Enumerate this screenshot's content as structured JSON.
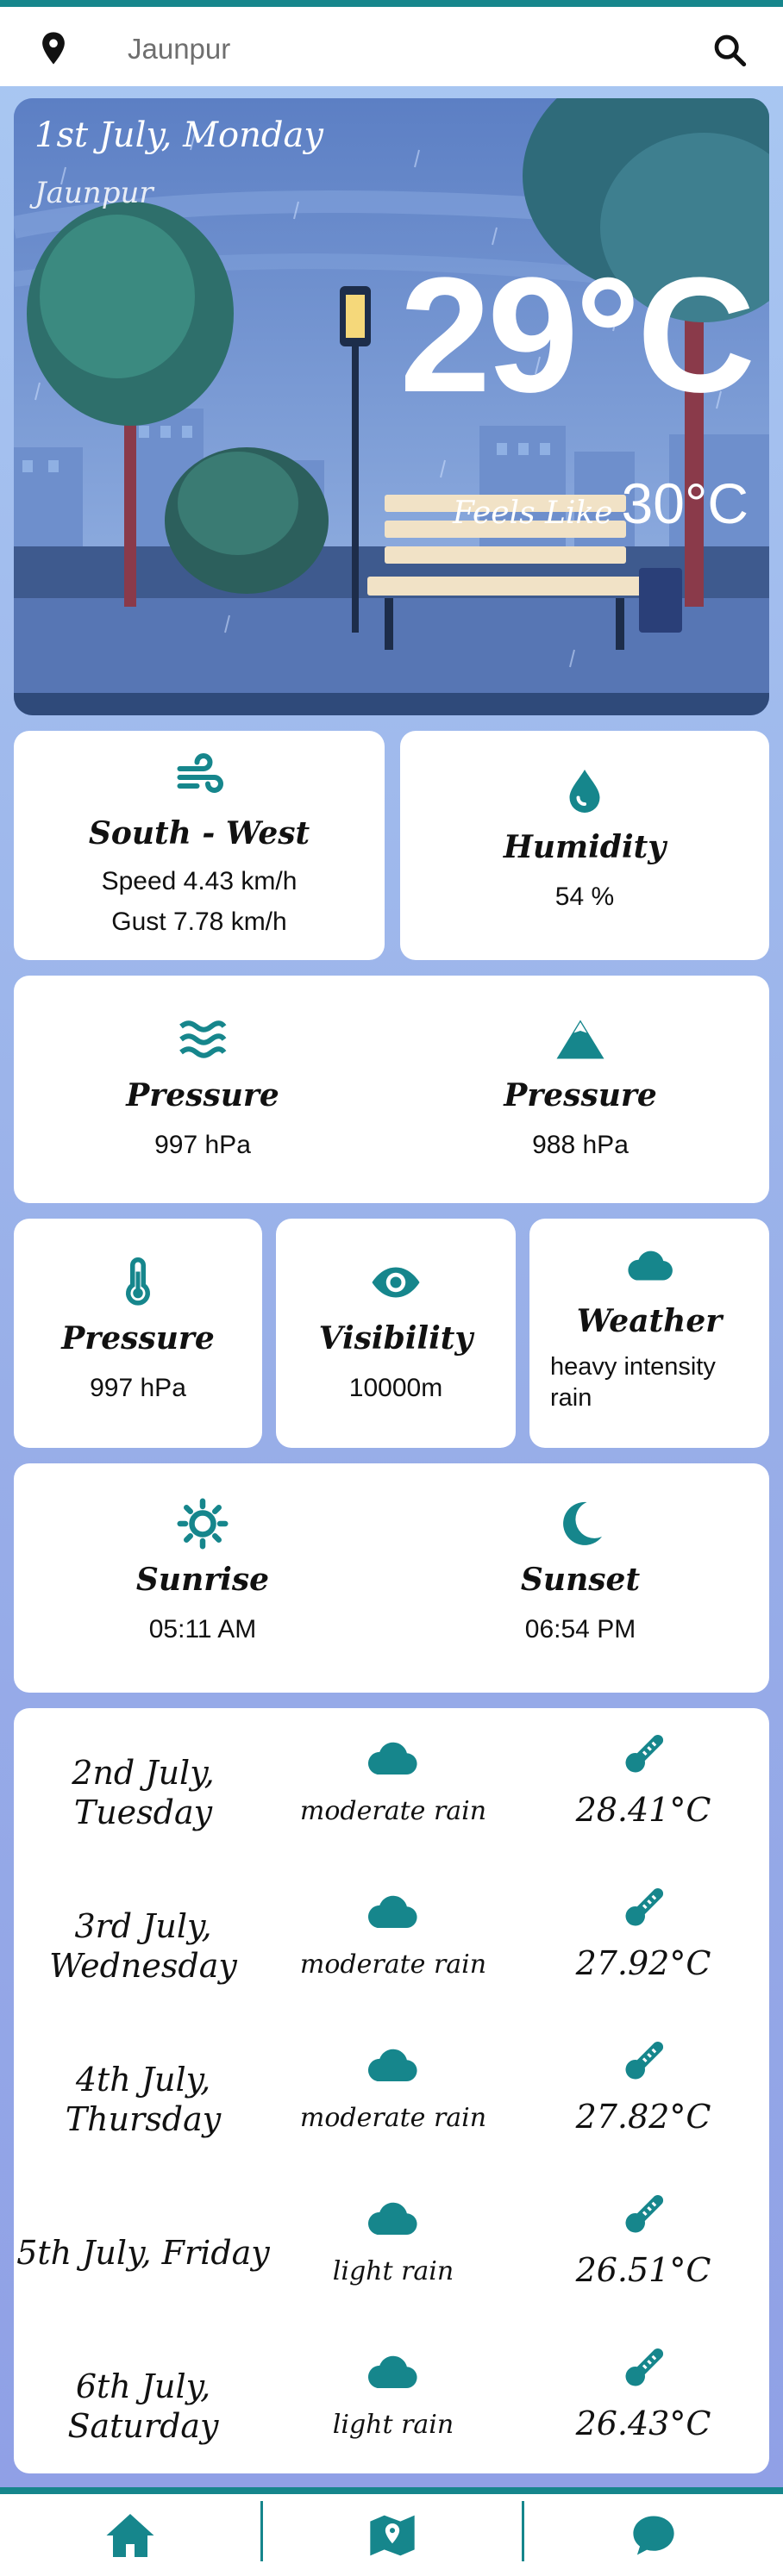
{
  "search": {
    "value": "Jaunpur",
    "icon_left": "location-pin-icon",
    "icon_right": "search-icon"
  },
  "hero": {
    "date": "1st July, Monday",
    "place": "Jaunpur",
    "temperature": "29°C",
    "feels_like_label": "Feels Like",
    "feels_like_value": "30°C"
  },
  "wind": {
    "icon": "wind-icon",
    "title": "South - West",
    "speed": "Speed 4.43 km/h",
    "gust": "Gust 7.78 km/h"
  },
  "humidity": {
    "icon": "water-drop-icon",
    "title": "Humidity",
    "value": "54 %"
  },
  "pressure_sea": {
    "icon": "waves-icon",
    "title": "Pressure",
    "value": "997 hPa"
  },
  "pressure_ground": {
    "icon": "mountain-icon",
    "title": "Pressure",
    "value": "988 hPa"
  },
  "pressure_small": {
    "icon": "thermometer-icon",
    "title": "Pressure",
    "value": "997 hPa"
  },
  "visibility": {
    "icon": "eye-icon",
    "title": "Visibility",
    "value": "10000m"
  },
  "weather": {
    "icon": "cloud-icon",
    "title": "Weather",
    "value": "heavy intensity rain"
  },
  "sunrise": {
    "icon": "sun-icon",
    "title": "Sunrise",
    "value": "05:11 AM"
  },
  "sunset": {
    "icon": "moon-icon",
    "title": "Sunset",
    "value": "06:54 PM"
  },
  "forecast": [
    {
      "date": "2nd July, Tuesday",
      "desc": "moderate rain",
      "temp": "28.41°C"
    },
    {
      "date": "3rd July, Wednesday",
      "desc": "moderate rain",
      "temp": "27.92°C"
    },
    {
      "date": "4th July, Thursday",
      "desc": "moderate rain",
      "temp": "27.82°C"
    },
    {
      "date": "5th July, Friday",
      "desc": "light rain",
      "temp": "26.51°C"
    },
    {
      "date": "6th July, Saturday",
      "desc": "light rain",
      "temp": "26.43°C"
    }
  ],
  "nav": [
    {
      "icon": "home-icon"
    },
    {
      "icon": "map-icon"
    },
    {
      "icon": "chat-icon"
    }
  ],
  "colors": {
    "accent": "#16868c",
    "card": "#ffffff"
  }
}
